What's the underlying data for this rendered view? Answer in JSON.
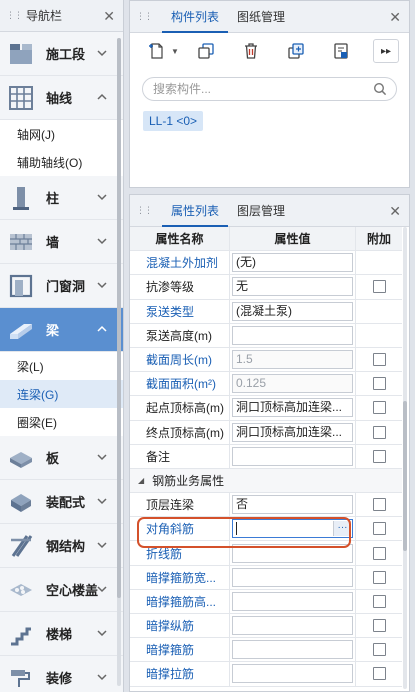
{
  "nav": {
    "title": "导航栏",
    "items": [
      {
        "label": "施工段",
        "icon": "construction-segment-icon",
        "expanded": false
      },
      {
        "label": "轴线",
        "icon": "axis-grid-icon",
        "expanded": true
      },
      {
        "label": "柱",
        "icon": "column-icon",
        "expanded": false
      },
      {
        "label": "墙",
        "icon": "wall-icon",
        "expanded": false
      },
      {
        "label": "门窗洞",
        "icon": "door-window-icon",
        "expanded": false
      },
      {
        "label": "梁",
        "icon": "beam-icon",
        "expanded": true,
        "active": true
      },
      {
        "label": "板",
        "icon": "slab-icon",
        "expanded": false
      },
      {
        "label": "装配式",
        "icon": "prefab-icon",
        "expanded": false
      },
      {
        "label": "钢结构",
        "icon": "steel-structure-icon",
        "expanded": false
      },
      {
        "label": "空心楼盖",
        "icon": "hollow-floor-icon",
        "expanded": false
      },
      {
        "label": "楼梯",
        "icon": "stairs-icon",
        "expanded": false
      },
      {
        "label": "装修",
        "icon": "decoration-icon",
        "expanded": false
      }
    ],
    "axis_children": [
      "轴网(J)",
      "辅助轴线(O)"
    ],
    "beam_children": [
      "梁(L)",
      "连梁(G)",
      "圈梁(E)"
    ],
    "selected_child": "连梁(G)"
  },
  "component_panel": {
    "tabs": [
      "构件列表",
      "图纸管理"
    ],
    "active_tab": "构件列表",
    "search_placeholder": "搜索构件...",
    "toolbar_icons": [
      "new-icon",
      "copy-icon",
      "delete-icon",
      "copy-to-floor-icon",
      "layer-copy-icon",
      "more-icon"
    ],
    "components": [
      "LL-1 <0>"
    ]
  },
  "property_panel": {
    "tabs": [
      "属性列表",
      "图层管理"
    ],
    "active_tab": "属性列表",
    "headers": {
      "name": "属性名称",
      "value": "属性值",
      "add": "附加"
    },
    "rows": [
      {
        "name": "混凝土外加剂",
        "value": "(无)",
        "blue": true,
        "checkbox": false
      },
      {
        "name": "抗渗等级",
        "value": "无",
        "blue": false,
        "checkbox": true
      },
      {
        "name": "泵送类型",
        "value": "(混凝土泵)",
        "blue": true,
        "checkbox": false
      },
      {
        "name": "泵送高度(m)",
        "value": "",
        "blue": false,
        "checkbox": false
      },
      {
        "name": "截面周长(m)",
        "value": "1.5",
        "blue": true,
        "gray": true,
        "checkbox": true
      },
      {
        "name": "截面面积(m²)",
        "value": "0.125",
        "blue": true,
        "gray": true,
        "checkbox": true
      },
      {
        "name": "起点顶标高(m)",
        "value": "洞口顶标高加连梁...",
        "blue": false,
        "checkbox": true
      },
      {
        "name": "终点顶标高(m)",
        "value": "洞口顶标高加连梁...",
        "blue": false,
        "checkbox": true
      },
      {
        "name": "备注",
        "value": "",
        "blue": false,
        "checkbox": true
      }
    ],
    "group": "钢筋业务属性",
    "group_rows": [
      {
        "name": "顶层连梁",
        "value": "否",
        "blue": false,
        "checkbox": true
      },
      {
        "name": "对角斜筋",
        "value": "",
        "blue": true,
        "checkbox": true,
        "editing": true
      },
      {
        "name": "折线筋",
        "value": "",
        "blue": true,
        "checkbox": true
      },
      {
        "name": "暗撑箍筋宽...",
        "value": "",
        "blue": true,
        "checkbox": true
      },
      {
        "name": "暗撑箍筋高...",
        "value": "",
        "blue": true,
        "checkbox": true
      },
      {
        "name": "暗撑纵筋",
        "value": "",
        "blue": true,
        "checkbox": true
      },
      {
        "name": "暗撑箍筋",
        "value": "",
        "blue": true,
        "checkbox": true
      },
      {
        "name": "暗撑拉筋",
        "value": "",
        "blue": true,
        "checkbox": true
      }
    ]
  },
  "colors": {
    "accent": "#1a5fb4",
    "active_nav": "#5a8fd0",
    "highlight": "#d4512b"
  }
}
